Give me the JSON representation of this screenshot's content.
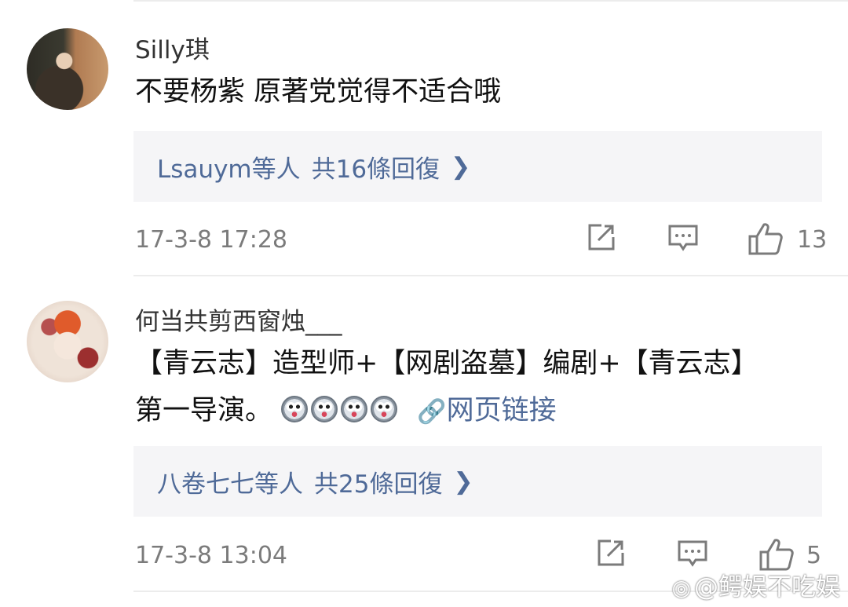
{
  "comments": [
    {
      "username": "Silly琪",
      "text_line1": "不要杨紫 原著党觉得不适合哦",
      "replies": {
        "names": "Lsauym等人",
        "count_label": "共16條回復"
      },
      "time": "17-3-8 17:28",
      "likes": "13"
    },
    {
      "username": "何当共剪西窗烛___",
      "text_line1": "【青云志】造型师+【网剧盗墓】编剧+【青云志】",
      "text_line2": "第一导演。",
      "emoji_count": 4,
      "link_label": "网页链接",
      "replies": {
        "names": "八卷七七等人",
        "count_label": "共25條回復"
      },
      "time": "17-3-8 13:04",
      "likes": "5"
    }
  ],
  "watermark": "@鳄娱不吃娱",
  "colors": {
    "link": "#4f6a98",
    "meta": "#7b7b7b",
    "reply_bg": "#f5f5f7"
  },
  "icons": [
    "share-icon",
    "comment-icon",
    "like-icon",
    "link-icon",
    "arrow-right-icon",
    "weibo-logo-icon"
  ]
}
